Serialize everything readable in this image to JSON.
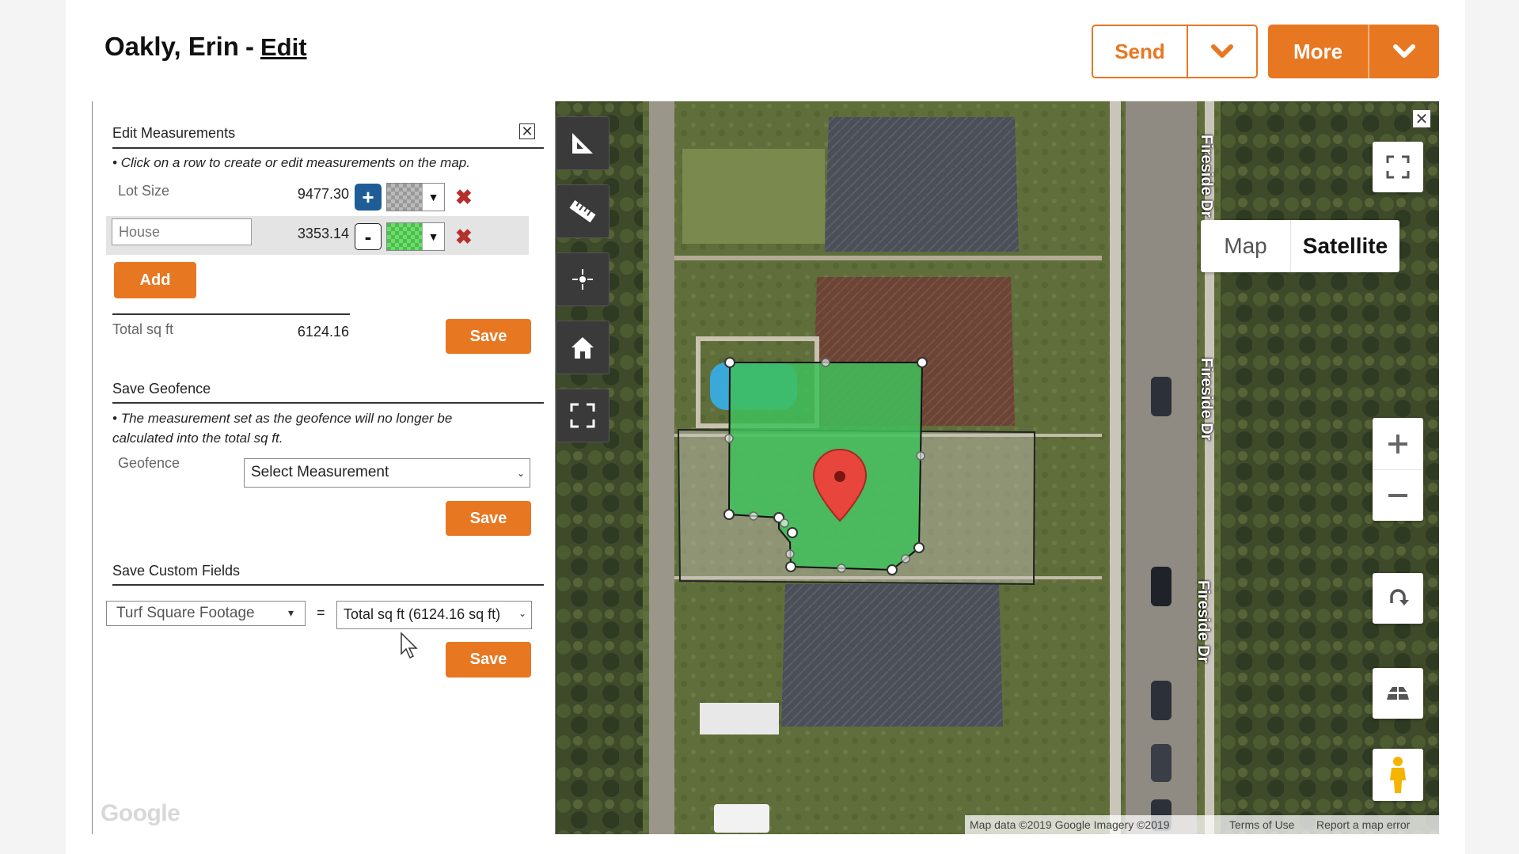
{
  "header": {
    "customer_name": "Oakly, Erin",
    "separator": "-",
    "edit_label": "Edit",
    "send_label": "Send",
    "more_label": "More"
  },
  "colors": {
    "accent": "#e87722",
    "plus_blue": "#1f5d96",
    "delete_red": "#b5302a",
    "measure_green": "#3fbf5a"
  },
  "measurements": {
    "title": "Edit Measurements",
    "instruction": "Click on a row to create or edit measurements on the map.",
    "rows": [
      {
        "label": "Lot Size",
        "value": "9477.30",
        "action": "+",
        "swatch": "gray-checker"
      },
      {
        "label": "",
        "placeholder": "House",
        "value": "3353.14",
        "action": "-",
        "swatch": "green-checker"
      }
    ],
    "add_label": "Add",
    "total_label": "Total sq ft",
    "total_value": "6124.16",
    "save_label": "Save"
  },
  "geofence": {
    "title": "Save Geofence",
    "note_line1": "The measurement set as the geofence will no longer be",
    "note_line2": "calculated into the total sq ft.",
    "field_label": "Geofence",
    "select_value": "Select Measurement",
    "save_label": "Save"
  },
  "custom_fields": {
    "title": "Save Custom Fields",
    "field_select": "Turf Square Footage",
    "equals": "=",
    "value_select": "Total sq ft (6124.16 sq ft)",
    "save_label": "Save"
  },
  "map": {
    "type_map": "Map",
    "type_satellite": "Satellite",
    "street_name": "Fireside Dr",
    "attribution": "Map data ©2019 Google Imagery ©2019",
    "terms": "Terms of Use",
    "report": "Report a map error",
    "google_logo": "Google",
    "tools": [
      "area-tool-icon",
      "ruler-icon",
      "crosshair-icon",
      "home-icon",
      "fit-bounds-icon"
    ]
  }
}
